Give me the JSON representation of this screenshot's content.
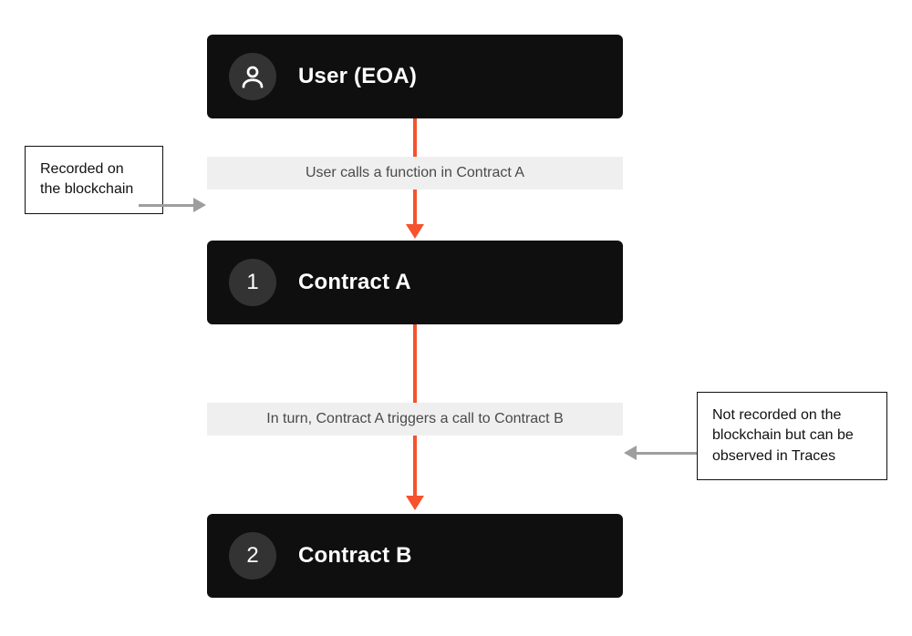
{
  "nodes": {
    "user": {
      "label": "User (EOA)"
    },
    "contractA": {
      "label": "Contract A",
      "num": "1"
    },
    "contractB": {
      "label": "Contract B",
      "num": "2"
    }
  },
  "steps": {
    "call1": {
      "text": "User calls a function in Contract A"
    },
    "call2": {
      "text": "In turn, Contract A triggers a call to Contract B"
    }
  },
  "notes": {
    "recorded": {
      "text": "Recorded on the blockchain"
    },
    "notrecorded": {
      "text": "Not recorded on the blockchain but can be observed in Traces"
    }
  },
  "colors": {
    "accent": "#f5522d",
    "muted": "#9e9e9e"
  }
}
